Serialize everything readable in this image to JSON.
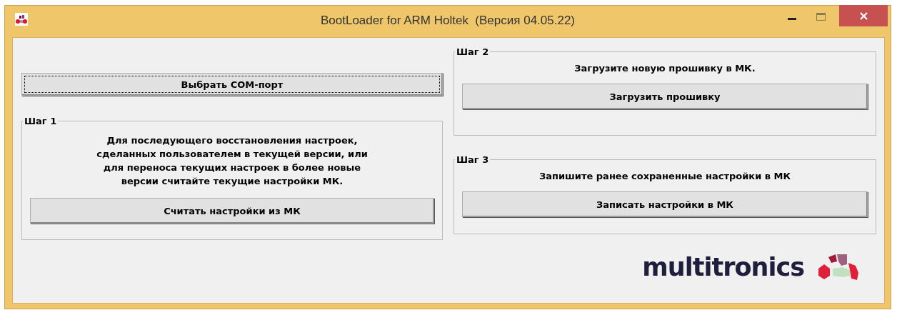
{
  "window": {
    "title": "BootLoader for ARM Holtek  (Версия 04.05.22)"
  },
  "com_port_button": {
    "label": "Выбрать COM-порт",
    "focused": true
  },
  "steps": [
    {
      "legend": "Шаг 1",
      "text": "Для последующего восстановления настроек,\nсделанных пользователем в текущей версии, или\nдля переноса текущих настроек в более новые\nверсии считайте текущие настройки МК.",
      "button": {
        "label": "Считать настройки из МК",
        "focused": false
      }
    },
    {
      "legend": "Шаг 2",
      "text": "Загрузите новую прошивку в МК.",
      "button": {
        "label": "Загрузить прошивку",
        "focused": false
      }
    },
    {
      "legend": "Шаг 3",
      "text": "Запишите ранее сохраненные настройки в МК",
      "button": {
        "label": "Записать настройки в МК",
        "focused": false
      }
    }
  ],
  "brand": {
    "name": "multitronics"
  }
}
